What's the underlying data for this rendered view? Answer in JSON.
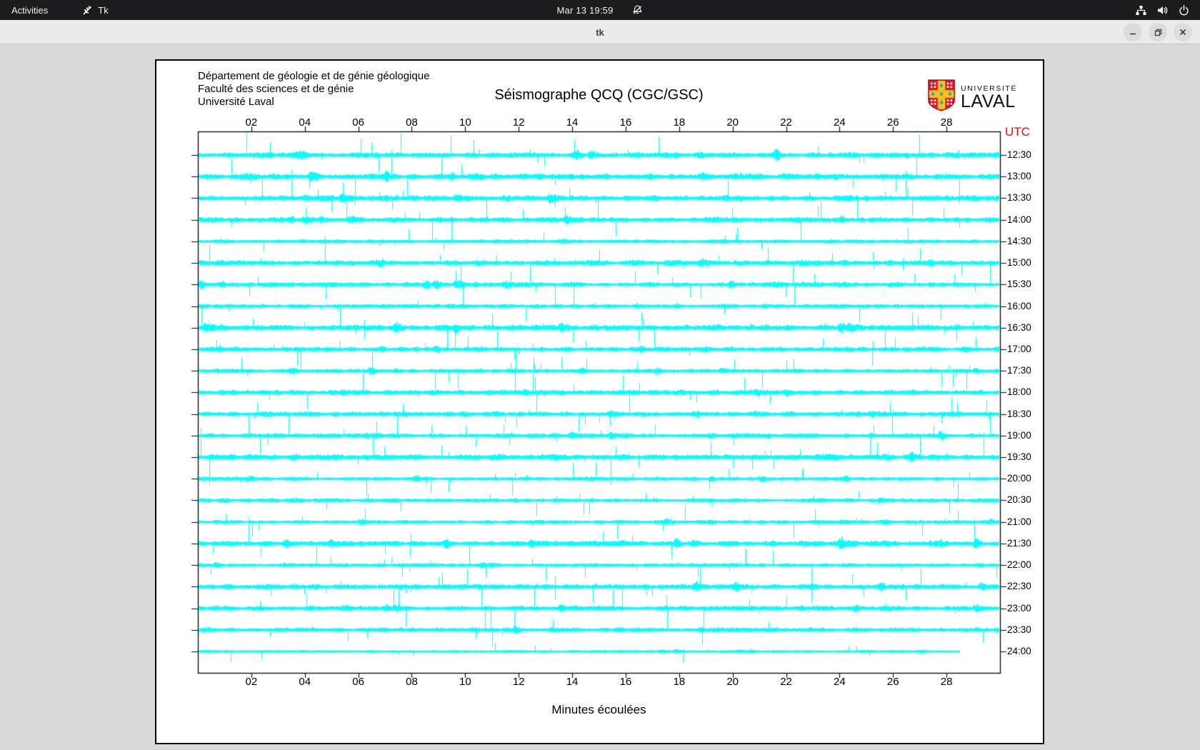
{
  "topbar": {
    "activities_label": "Activities",
    "app_indicator": {
      "icon": "tk-feather-icon",
      "label": "Tk"
    },
    "clock": "Mar 13  19:59",
    "notifications_icon": "bell-slash-icon",
    "tray_icons": [
      "network-icon",
      "volume-icon",
      "power-icon"
    ]
  },
  "window": {
    "title": "tk",
    "controls": [
      "minimize",
      "maximize",
      "close"
    ]
  },
  "canvas": {
    "address_lines": [
      "Département de géologie et de génie géologique",
      "Faculté des sciences et de génie",
      "Université Laval"
    ],
    "logo": {
      "line1": "UNIVERSITÉ",
      "line2": "LAVAL"
    }
  },
  "chart_data": {
    "type": "line",
    "title": "Séismographe QCQ (CGC/GSC)",
    "xlabel": "Minutes écoulées",
    "right_axis_label": "UTC",
    "x_range_minutes": [
      0,
      30
    ],
    "x_tick_minutes": [
      2,
      4,
      6,
      8,
      10,
      12,
      14,
      16,
      18,
      20,
      22,
      24,
      26,
      28
    ],
    "x_tick_labels": [
      "02",
      "04",
      "06",
      "08",
      "10",
      "12",
      "14",
      "16",
      "18",
      "20",
      "22",
      "24",
      "26",
      "28"
    ],
    "grid": false,
    "trace_color": "#00ffff",
    "utc_label_color": "#ff0000",
    "axis_color": "#000000",
    "rows": [
      {
        "label": "12:30",
        "end_minute": 30
      },
      {
        "label": "13:00",
        "end_minute": 30
      },
      {
        "label": "13:30",
        "end_minute": 30
      },
      {
        "label": "14:00",
        "end_minute": 30
      },
      {
        "label": "14:30",
        "end_minute": 30
      },
      {
        "label": "15:00",
        "end_minute": 30
      },
      {
        "label": "15:30",
        "end_minute": 30
      },
      {
        "label": "16:00",
        "end_minute": 30
      },
      {
        "label": "16:30",
        "end_minute": 30
      },
      {
        "label": "17:00",
        "end_minute": 30
      },
      {
        "label": "17:30",
        "end_minute": 30
      },
      {
        "label": "18:00",
        "end_minute": 30
      },
      {
        "label": "18:30",
        "end_minute": 30
      },
      {
        "label": "19:00",
        "end_minute": 30
      },
      {
        "label": "19:30",
        "end_minute": 30
      },
      {
        "label": "20:00",
        "end_minute": 30
      },
      {
        "label": "20:30",
        "end_minute": 30
      },
      {
        "label": "21:00",
        "end_minute": 30
      },
      {
        "label": "21:30",
        "end_minute": 30
      },
      {
        "label": "22:00",
        "end_minute": 30
      },
      {
        "label": "22:30",
        "end_minute": 30
      },
      {
        "label": "23:00",
        "end_minute": 30
      },
      {
        "label": "23:30",
        "end_minute": 30
      },
      {
        "label": "24:00",
        "end_minute": 28.5
      }
    ]
  }
}
